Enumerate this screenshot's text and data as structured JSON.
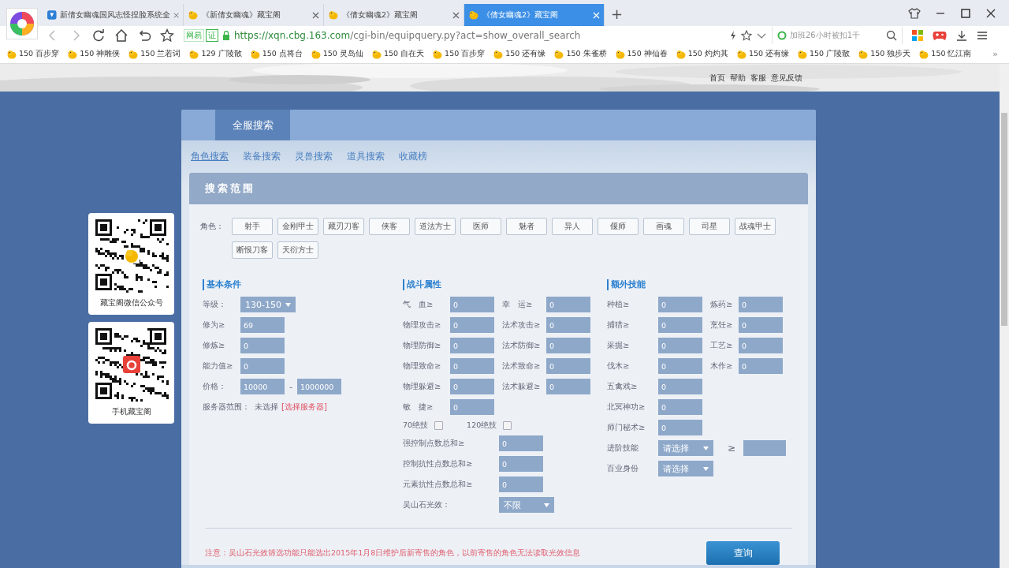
{
  "browser": {
    "tabs": [
      {
        "title": "新倩女幽魂国风志怪捏脸系统全",
        "selected": false
      },
      {
        "title": "《新倩女幽魂》藏宝阁",
        "selected": false
      },
      {
        "title": "《倩女幽魂2》藏宝阁",
        "selected": false
      },
      {
        "title": "《倩女幽魂2》藏宝阁",
        "selected": true
      }
    ],
    "new_tab": "+",
    "site_badge": "网易",
    "cert_badge": "证",
    "url": "https://xqn.cbg.163.com/cgi-bin/equipquery.py?act=show_overall_search",
    "search_placeholder": "加班26小时被扣1千",
    "bookmarks": [
      "150 百步穿",
      "150 神雕侠",
      "150 兰若词",
      "129 广陵散",
      "150 点将台",
      "150 灵岛仙",
      "150 自在天",
      "150 百步穿",
      "150 还有缘",
      "150 朱雀桥",
      "150 神仙眷",
      "150 灼灼其",
      "150 还有缘",
      "150 广陵散",
      "150 独步天",
      "150 忆江南"
    ],
    "more": "»"
  },
  "page": {
    "header_links": [
      "首页",
      "帮助",
      "客服",
      "意见反馈"
    ],
    "qr_cards": [
      {
        "caption": "藏宝阁微信公众号"
      },
      {
        "caption": "手机藏宝阁"
      }
    ],
    "main_tab": "全服搜索",
    "subtabs": [
      {
        "label": "角色搜索",
        "selected": true
      },
      {
        "label": "装备搜索",
        "selected": false
      },
      {
        "label": "灵兽搜索",
        "selected": false
      },
      {
        "label": "道具搜索",
        "selected": false
      },
      {
        "label": "收藏榜",
        "selected": false
      }
    ],
    "section_title": "搜索范围",
    "role_label": "角色：",
    "roles": [
      {
        "label": "射手",
        "selected": false
      },
      {
        "label": "金刚甲士",
        "selected": false
      },
      {
        "label": "藏刃刀客",
        "selected": false
      },
      {
        "label": "侠客",
        "selected": false
      },
      {
        "label": "道法方士",
        "selected": false
      },
      {
        "label": "医师",
        "selected": false
      },
      {
        "label": "魅者",
        "selected": false
      },
      {
        "label": "异人",
        "selected": false
      },
      {
        "label": "偃师",
        "selected": false
      },
      {
        "label": "画魂",
        "selected": false
      },
      {
        "label": "司星",
        "selected": false
      },
      {
        "label": "战魂甲士",
        "selected": false
      },
      {
        "label": "断恨刀客",
        "selected": false
      },
      {
        "label": "天衍方士",
        "selected": false
      }
    ],
    "columns": [
      {
        "kind": "basic",
        "title": "基本条件",
        "rows": [
          {
            "kind": "short",
            "cells": [
              {
                "kind": "select",
                "label": "等级：",
                "value": "130-150"
              }
            ]
          },
          {
            "kind": "short",
            "cells": [
              {
                "kind": "input",
                "label": "修为≥",
                "value": "69"
              }
            ]
          },
          {
            "kind": "short",
            "cells": [
              {
                "kind": "input",
                "label": "修炼≥",
                "value": "0"
              }
            ]
          },
          {
            "kind": "short",
            "cells": [
              {
                "kind": "input",
                "label": "能力值≥",
                "value": "0"
              }
            ]
          },
          {
            "kind": "short",
            "cells": [
              {
                "kind": "range",
                "label": "价格：",
                "value": "10000",
                "separator": "-",
                "to": "1000000"
              }
            ]
          },
          {
            "kind": "short",
            "cells": [
              {
                "kind": "server",
                "label": "服务器范围：",
                "value": "未选择",
                "link": "[选择服务器]"
              }
            ]
          }
        ]
      },
      {
        "kind": "battle",
        "title": "战斗属性",
        "rows": [
          {
            "kind": "short",
            "cells": [
              {
                "kind": "input",
                "label": "气　血≥",
                "value": "0"
              },
              {
                "kind": "input",
                "label": "幸　运≥",
                "value": "0"
              }
            ]
          },
          {
            "kind": "short",
            "cells": [
              {
                "kind": "input",
                "label": "物理攻击≥",
                "value": "0"
              },
              {
                "kind": "input",
                "label": "法术攻击≥",
                "value": "0"
              }
            ]
          },
          {
            "kind": "short",
            "cells": [
              {
                "kind": "input",
                "label": "物理防御≥",
                "value": "0"
              },
              {
                "kind": "input",
                "label": "法术防御≥",
                "value": "0"
              }
            ]
          },
          {
            "kind": "short",
            "cells": [
              {
                "kind": "input",
                "label": "物理致命≥",
                "value": "0"
              },
              {
                "kind": "input",
                "label": "法术致命≥",
                "value": "0"
              }
            ]
          },
          {
            "kind": "short",
            "cells": [
              {
                "kind": "input",
                "label": "物理躲避≥",
                "value": "0"
              },
              {
                "kind": "input",
                "label": "法术躲避≥",
                "value": "0"
              }
            ]
          },
          {
            "kind": "short",
            "cells": [
              {
                "kind": "input",
                "label": "敏　捷≥",
                "value": "0"
              }
            ]
          },
          {
            "kind": "check",
            "cells": [
              {
                "kind": "checkbox",
                "label": "70绝技",
                "checked": false
              },
              {
                "kind": "checkbox",
                "label": "120绝技",
                "checked": false
              }
            ]
          },
          {
            "kind": "long",
            "cells": [
              {
                "kind": "input",
                "label": "强控制点数总和≥",
                "value": "0"
              }
            ]
          },
          {
            "kind": "long",
            "cells": [
              {
                "kind": "input",
                "label": "控制抗性点数总和≥",
                "value": "0"
              }
            ]
          },
          {
            "kind": "long",
            "cells": [
              {
                "kind": "input",
                "label": "元素抗性点数总和≥",
                "value": "0"
              }
            ]
          },
          {
            "kind": "long",
            "cells": [
              {
                "kind": "select",
                "label": "吴山石光效：",
                "value": "不限"
              }
            ]
          }
        ]
      },
      {
        "kind": "extra",
        "title": "额外技能",
        "rows": [
          {
            "kind": "short",
            "cells": [
              {
                "kind": "input",
                "label": "种植≥",
                "value": "0"
              },
              {
                "kind": "input",
                "label": "炼药≥",
                "value": "0"
              }
            ]
          },
          {
            "kind": "short",
            "cells": [
              {
                "kind": "input",
                "label": "捕猎≥",
                "value": "0"
              },
              {
                "kind": "input",
                "label": "烹饪≥",
                "value": "0"
              }
            ]
          },
          {
            "kind": "short",
            "cells": [
              {
                "kind": "input",
                "label": "采掘≥",
                "value": "0"
              },
              {
                "kind": "input",
                "label": "工艺≥",
                "value": "0"
              }
            ]
          },
          {
            "kind": "short",
            "cells": [
              {
                "kind": "input",
                "label": "伐木≥",
                "value": "0"
              },
              {
                "kind": "input",
                "label": "木作≥",
                "value": "0"
              }
            ]
          },
          {
            "kind": "short",
            "cells": [
              {
                "kind": "input",
                "label": "五禽戏≥",
                "value": "0"
              }
            ]
          },
          {
            "kind": "short",
            "cells": [
              {
                "kind": "input",
                "label": "北冥神功≥",
                "value": "0"
              }
            ]
          },
          {
            "kind": "short",
            "cells": [
              {
                "kind": "input",
                "label": "师门秘术≥",
                "value": "0"
              }
            ]
          },
          {
            "kind": "short",
            "cells": [
              {
                "kind": "select",
                "label": "进阶技能",
                "value": "请选择"
              },
              {
                "kind": "compare",
                "label": "≥"
              }
            ]
          },
          {
            "kind": "short",
            "cells": [
              {
                "kind": "select",
                "label": "百业身份",
                "value": "请选择"
              }
            ]
          }
        ]
      }
    ],
    "notice": "注意：吴山石光效筛选功能只能选出2015年1月8日维护后新寄售的角色，以前寄售的角色无法读取光效信息",
    "query_button": "查询"
  }
}
